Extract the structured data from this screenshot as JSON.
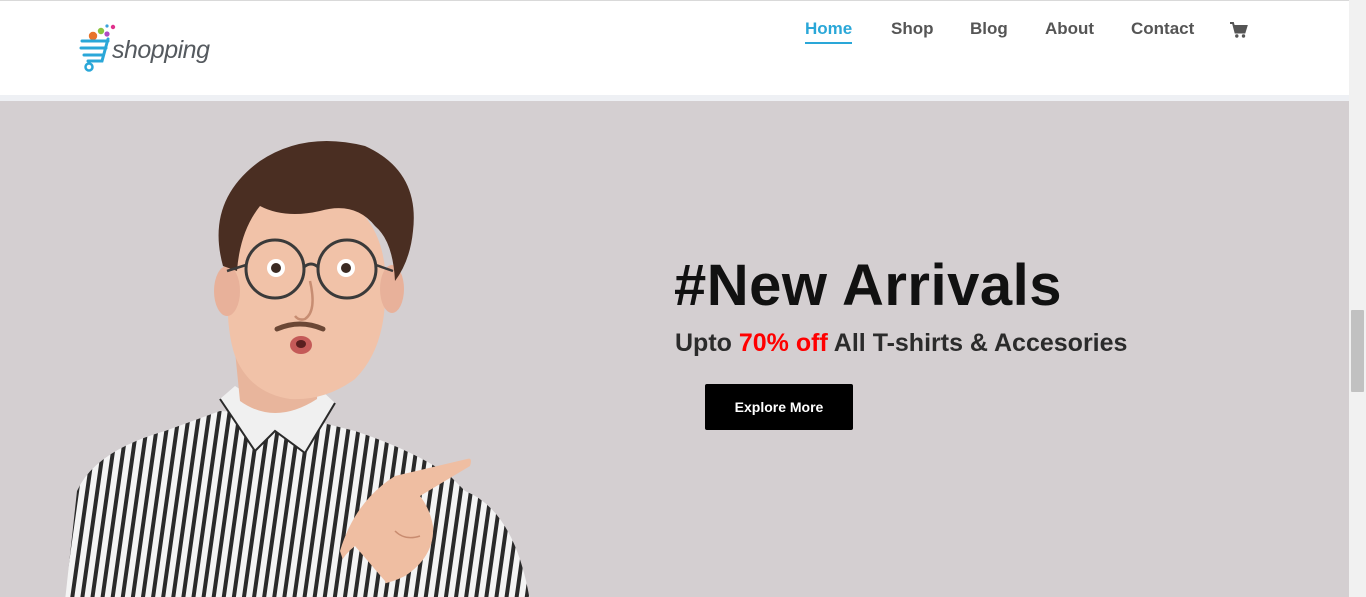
{
  "brand": {
    "logo_text": "shopping",
    "accent_color": "#2aa7d8"
  },
  "nav": {
    "items": [
      {
        "label": "Home",
        "active": true
      },
      {
        "label": "Shop",
        "active": false
      },
      {
        "label": "Blog",
        "active": false
      },
      {
        "label": "About",
        "active": false
      },
      {
        "label": "Contact",
        "active": false
      }
    ],
    "cart_icon": "shopping-cart-icon"
  },
  "hero": {
    "headline": "#New Arrivals",
    "subline_prefix": "Upto ",
    "subline_highlight": "70% off",
    "subline_suffix": " All T-shirts & Accesories",
    "highlight_color": "#ff0000",
    "cta_label": "Explore More",
    "background_color": "#d4cfd1"
  },
  "scrollbar": {
    "position": "middle"
  }
}
